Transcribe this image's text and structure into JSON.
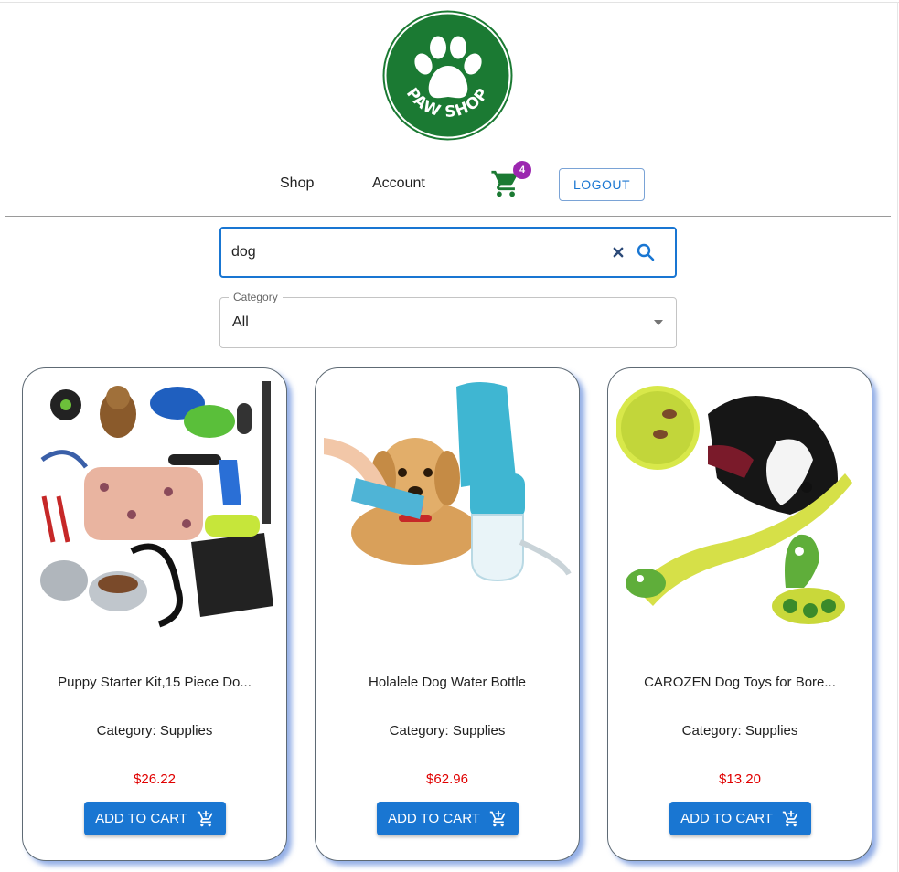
{
  "logo": {
    "text": "PAW SHOP",
    "color": "#1b7a33"
  },
  "nav": {
    "shop": "Shop",
    "account": "Account",
    "cart_count": "4",
    "logout": "LOGOUT"
  },
  "search": {
    "value": "dog"
  },
  "category": {
    "label": "Category",
    "value": "All"
  },
  "colors": {
    "accent": "#1976d2",
    "price": "#e00000",
    "badge": "#9c27b0",
    "cart": "#1b7a33"
  },
  "products": [
    {
      "title": "Puppy Starter Kit,15 Piece Do...",
      "category": "Category: Supplies",
      "price": "$26.22",
      "button": "ADD TO CART",
      "image": "puppy-starter-kit-image"
    },
    {
      "title": "Holalele Dog Water Bottle",
      "category": "Category: Supplies",
      "price": "$62.96",
      "button": "ADD TO CART",
      "image": "dog-water-bottle-image"
    },
    {
      "title": "CAROZEN Dog Toys for Bore...",
      "category": "Category: Supplies",
      "price": "$13.20",
      "button": "ADD TO CART",
      "image": "dog-toy-snake-image"
    }
  ]
}
